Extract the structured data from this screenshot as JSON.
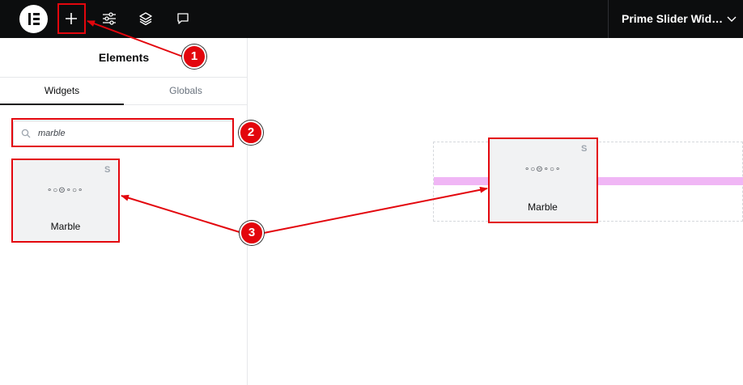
{
  "topbar": {
    "logo_icon": "elementor-logo-icon",
    "buttons": [
      {
        "name": "add-element-button",
        "icon": "plus-icon"
      },
      {
        "name": "site-settings-button",
        "icon": "sliders-icon"
      },
      {
        "name": "structure-button",
        "icon": "layers-icon"
      },
      {
        "name": "comments-button",
        "icon": "chat-bubble-icon"
      }
    ],
    "page_title": "Prime Slider Wid…",
    "chevron_icon": "chevron-down-icon"
  },
  "panel": {
    "title": "Elements",
    "tabs": [
      {
        "label": "Widgets",
        "active": true
      },
      {
        "label": "Globals",
        "active": false
      }
    ],
    "search": {
      "value": "marble",
      "icon": "search-icon"
    },
    "widget": {
      "label": "Marble",
      "glyph": "∘○⊝∘○∘",
      "badge": "S"
    }
  },
  "canvas": {
    "drag_widget": {
      "label": "Marble",
      "glyph": "∘○⊝∘○∘",
      "badge": "S"
    }
  },
  "annotations": {
    "callouts": [
      "1",
      "2",
      "3"
    ],
    "color": "#e3060d"
  },
  "colors": {
    "topbar": "#0c0d0e",
    "drop_indicator": "#f0b6f5",
    "annotation": "#e3060d"
  }
}
